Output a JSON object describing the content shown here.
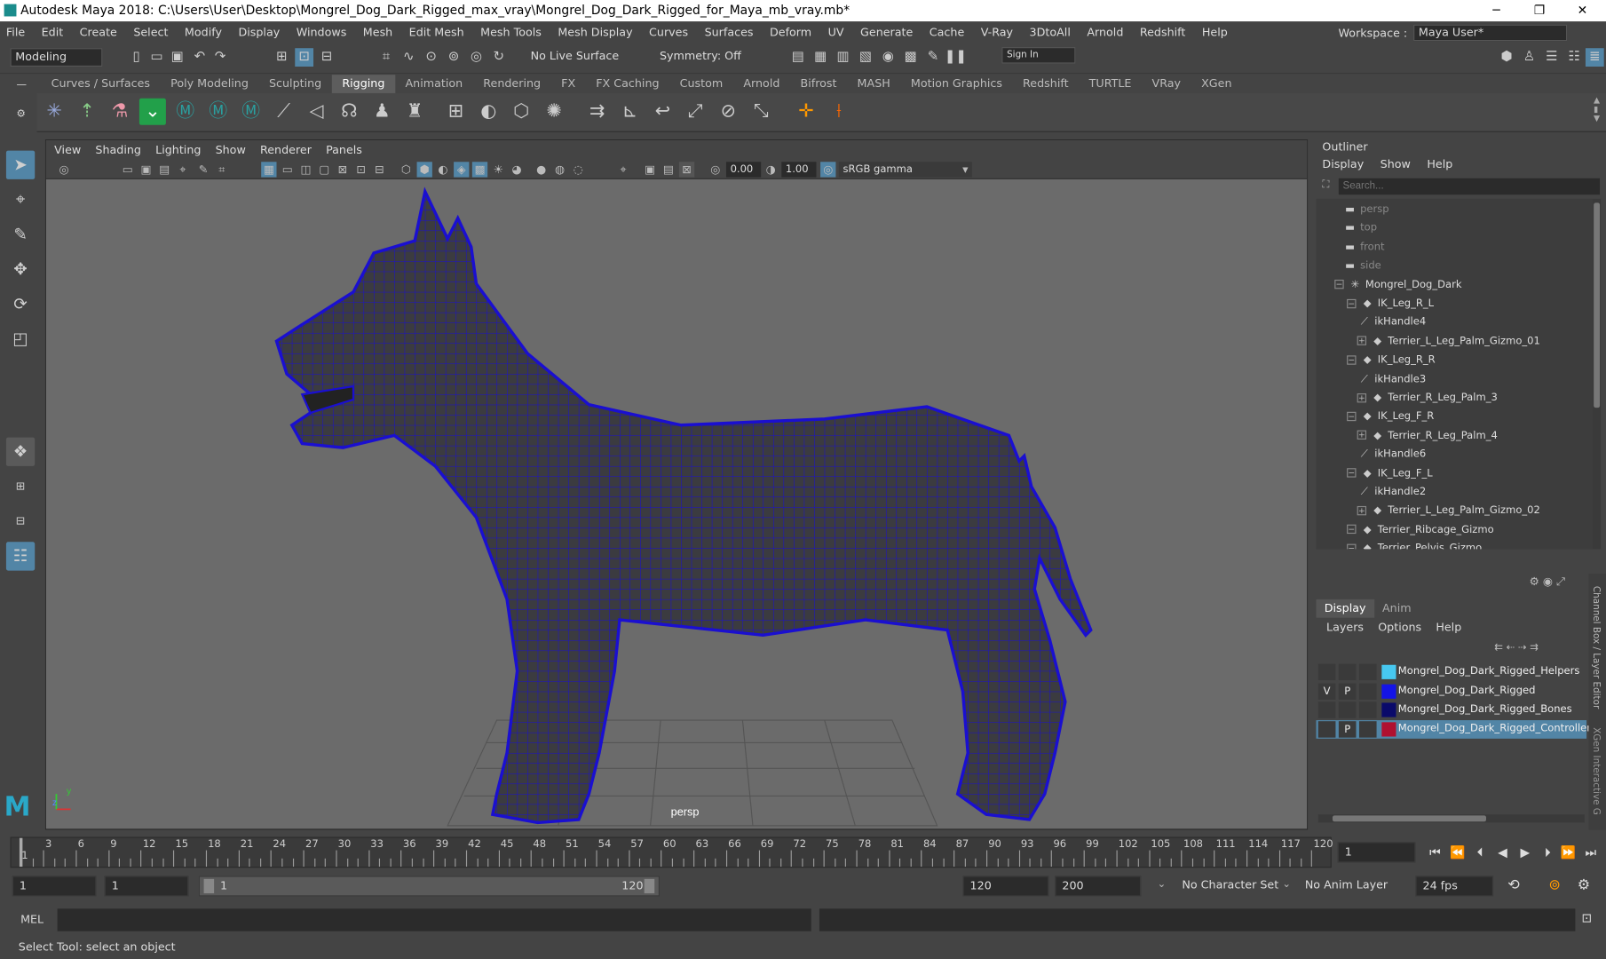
{
  "window": {
    "title": "Autodesk Maya 2018: C:\\Users\\User\\Desktop\\Mongrel_Dog_Dark_Rigged_max_vray\\Mongrel_Dog_Dark_Rigged_for_Maya_mb_vray.mb*",
    "minimize": "─",
    "maximize": "❐",
    "close": "✕"
  },
  "menubar": [
    "File",
    "Edit",
    "Create",
    "Select",
    "Modify",
    "Display",
    "Windows",
    "Mesh",
    "Edit Mesh",
    "Mesh Tools",
    "Mesh Display",
    "Curves",
    "Surfaces",
    "Deform",
    "UV",
    "Generate",
    "Cache",
    "V-Ray",
    "3DtoAll",
    "Arnold",
    "Redshift",
    "Help"
  ],
  "workspace": {
    "label": "Workspace :",
    "value": "Maya User*"
  },
  "statusline": {
    "mode": "Modeling",
    "live_surface": "No Live Surface",
    "symmetry": "Symmetry: Off",
    "sign_in": "Sign In"
  },
  "shelf_tabs": [
    "Curves / Surfaces",
    "Poly Modeling",
    "Sculpting",
    "Rigging",
    "Animation",
    "Rendering",
    "FX",
    "FX Caching",
    "Custom",
    "Arnold",
    "Bifrost",
    "MASH",
    "Motion Graphics",
    "Redshift",
    "TURTLE",
    "VRay",
    "XGen"
  ],
  "active_shelf": "Rigging",
  "viewport": {
    "menu": [
      "View",
      "Shading",
      "Lighting",
      "Show",
      "Renderer",
      "Panels"
    ],
    "near": "0.00",
    "far": "1.00",
    "color_space": "sRGB gamma",
    "camera": "persp",
    "axis_y": "y",
    "axis_z": "z"
  },
  "outliner": {
    "title": "Outliner",
    "menu": [
      "Display",
      "Show",
      "Help"
    ],
    "search_placeholder": "Search...",
    "items": [
      {
        "label": "persp",
        "depth": 0,
        "dim": true
      },
      {
        "label": "top",
        "depth": 0,
        "dim": true
      },
      {
        "label": "front",
        "depth": 0,
        "dim": true
      },
      {
        "label": "side",
        "depth": 0,
        "dim": true
      },
      {
        "label": "Mongrel_Dog_Dark",
        "depth": 0,
        "dim": false
      },
      {
        "label": "IK_Leg_R_L",
        "depth": 1,
        "dim": false
      },
      {
        "label": "ikHandle4",
        "depth": 2,
        "dim": false
      },
      {
        "label": "Terrier_L_Leg_Palm_Gizmo_01",
        "depth": 2,
        "dim": false
      },
      {
        "label": "IK_Leg_R_R",
        "depth": 1,
        "dim": false
      },
      {
        "label": "ikHandle3",
        "depth": 2,
        "dim": false
      },
      {
        "label": "Terrier_R_Leg_Palm_3",
        "depth": 2,
        "dim": false
      },
      {
        "label": "IK_Leg_F_R",
        "depth": 1,
        "dim": false
      },
      {
        "label": "Terrier_R_Leg_Palm_4",
        "depth": 2,
        "dim": false
      },
      {
        "label": "ikHandle6",
        "depth": 2,
        "dim": false
      },
      {
        "label": "IK_Leg_F_L",
        "depth": 1,
        "dim": false
      },
      {
        "label": "ikHandle2",
        "depth": 2,
        "dim": false
      },
      {
        "label": "Terrier_L_Leg_Palm_Gizmo_02",
        "depth": 2,
        "dim": false
      },
      {
        "label": "Terrier_Ribcage_Gizmo",
        "depth": 1,
        "dim": false
      },
      {
        "label": "Terrier_Pelvis_Gizmo",
        "depth": 1,
        "dim": false
      }
    ]
  },
  "layer_editor": {
    "tabs": [
      "Display",
      "Anim"
    ],
    "menu": [
      "Layers",
      "Options",
      "Help"
    ],
    "side_label": "Channel Box / Layer Editor",
    "side_label2": "XGen Interactive G",
    "layers": [
      {
        "v": "",
        "p": "",
        "name": "Mongrel_Dog_Dark_Rigged_Helpers",
        "color": "#47c8f0",
        "selected": false
      },
      {
        "v": "V",
        "p": "P",
        "name": "Mongrel_Dog_Dark_Rigged",
        "color": "#1414e6",
        "selected": false
      },
      {
        "v": "",
        "p": "",
        "name": "Mongrel_Dog_Dark_Rigged_Bones",
        "color": "#0a0a6a",
        "selected": false
      },
      {
        "v": "",
        "p": "P",
        "name": "Mongrel_Dog_Dark_Rigged_Controllers",
        "color": "#b01030",
        "selected": true
      }
    ]
  },
  "timeline": {
    "ticks": [
      "3",
      "6",
      "9",
      "12",
      "15",
      "18",
      "21",
      "24",
      "27",
      "30",
      "33",
      "36",
      "39",
      "42",
      "45",
      "48",
      "51",
      "54",
      "57",
      "60",
      "63",
      "66",
      "69",
      "72",
      "75",
      "78",
      "81",
      "84",
      "87",
      "90",
      "93",
      "96",
      "99",
      "102",
      "105",
      "108",
      "111",
      "114",
      "117",
      "120"
    ],
    "first_tick": "1",
    "current_frame": "1"
  },
  "range": {
    "start": "1",
    "playback_start": "1",
    "slider_start": "1",
    "slider_end": "120",
    "playback_end": "120",
    "end": "200",
    "character_set": "No Character Set",
    "anim_layer": "No Anim Layer",
    "fps": "24 fps"
  },
  "command": {
    "label": "MEL"
  },
  "help_line": "Select Tool: select an object",
  "colors": {
    "wire": "#1a0fd0",
    "mesh": "#3b3b40",
    "accent": "#5285a6"
  }
}
